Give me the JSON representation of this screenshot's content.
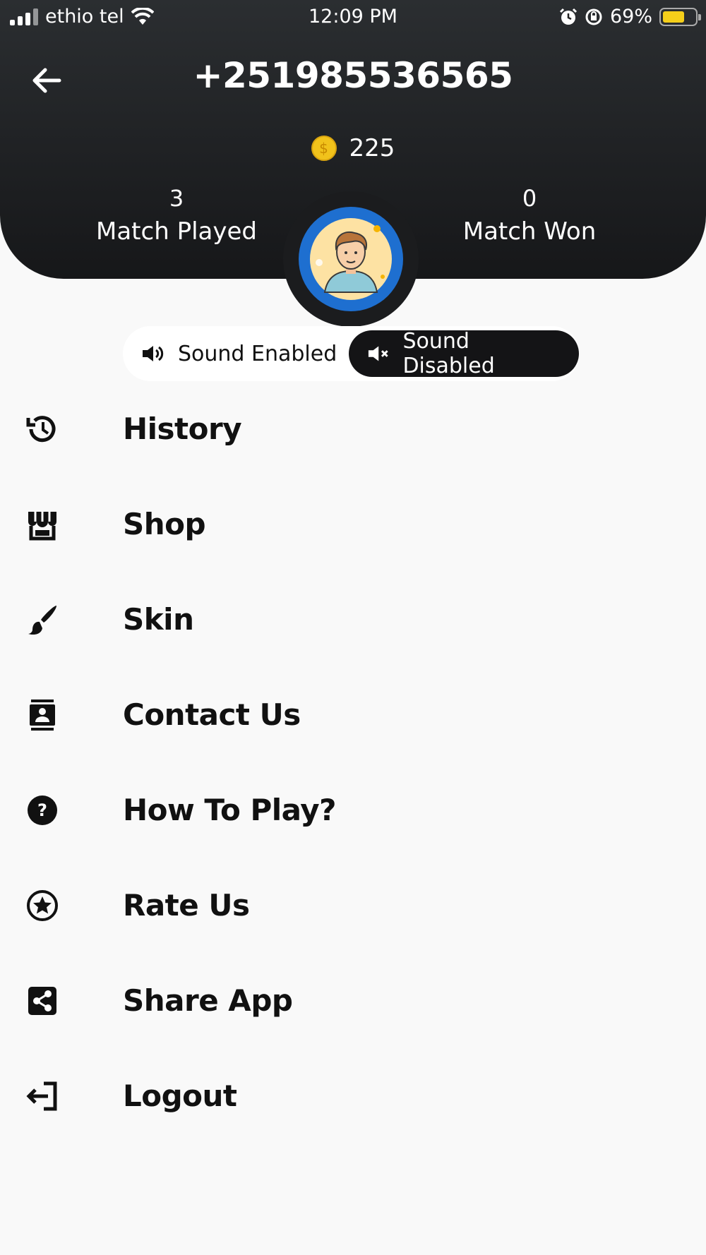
{
  "status_bar": {
    "carrier": "ethio tel",
    "time": "12:09 PM",
    "battery": "69%",
    "battery_level": 0.69
  },
  "header": {
    "title": "+251985536565",
    "coins": "225",
    "stats": {
      "played_value": "3",
      "played_label": "Match Played",
      "won_value": "0",
      "won_label": "Match Won"
    }
  },
  "sound": {
    "enabled_label": "Sound Enabled",
    "disabled_label": "Sound Disabled",
    "selected": "disabled"
  },
  "menu": [
    {
      "label": "History",
      "icon": "history-icon"
    },
    {
      "label": "Shop",
      "icon": "shop-icon"
    },
    {
      "label": "Skin",
      "icon": "brush-icon"
    },
    {
      "label": "Contact Us",
      "icon": "contact-icon"
    },
    {
      "label": "How To Play?",
      "icon": "help-icon"
    },
    {
      "label": "Rate Us",
      "icon": "star-icon"
    },
    {
      "label": "Share App",
      "icon": "share-icon"
    },
    {
      "label": "Logout",
      "icon": "logout-icon"
    }
  ],
  "colors": {
    "header_dark": "#1e2023",
    "accent_blue": "#1e6fd0",
    "coin_gold": "#f1c21b",
    "background": "#f9f9f9"
  }
}
